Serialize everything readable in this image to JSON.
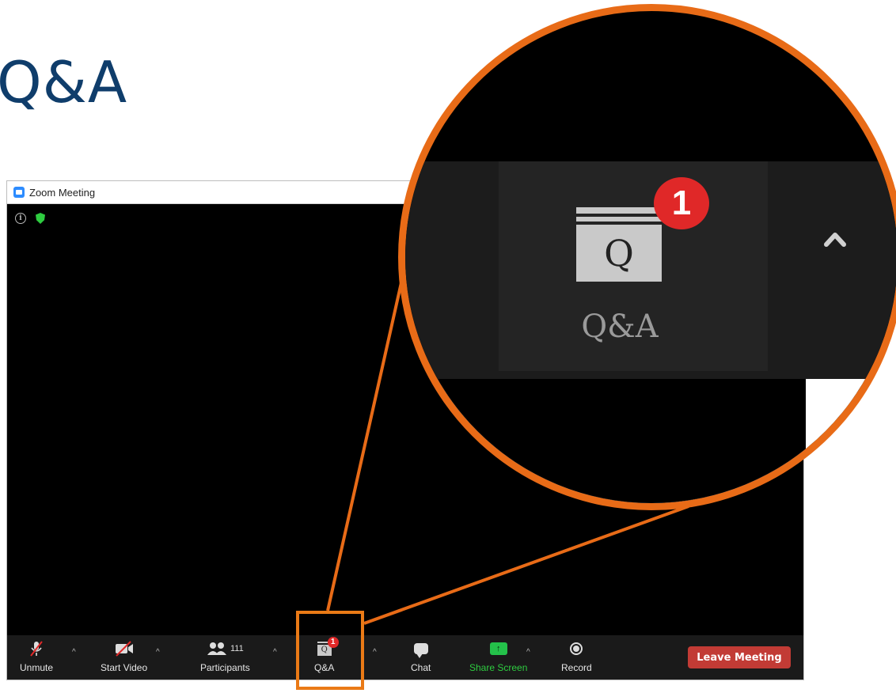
{
  "slide": {
    "title": "Q&A"
  },
  "window": {
    "title": "Zoom Meeting"
  },
  "toolbar": {
    "unmute": "Unmute",
    "start_video": "Start Video",
    "participants": "Participants",
    "participants_count": "111",
    "qa": "Q&A",
    "qa_icon_letter": "Q",
    "qa_badge": "1",
    "chat": "Chat",
    "share_screen": "Share Screen",
    "record": "Record",
    "leave": "Leave Meeting"
  },
  "magnifier": {
    "qa_icon_letter": "Q",
    "qa_badge": "1",
    "qa_label": "Q&A"
  },
  "colors": {
    "title": "#0f3d6b",
    "callout": "#e86b17",
    "leave": "#c23b35",
    "share": "#24c14a",
    "badge": "#e02828"
  }
}
